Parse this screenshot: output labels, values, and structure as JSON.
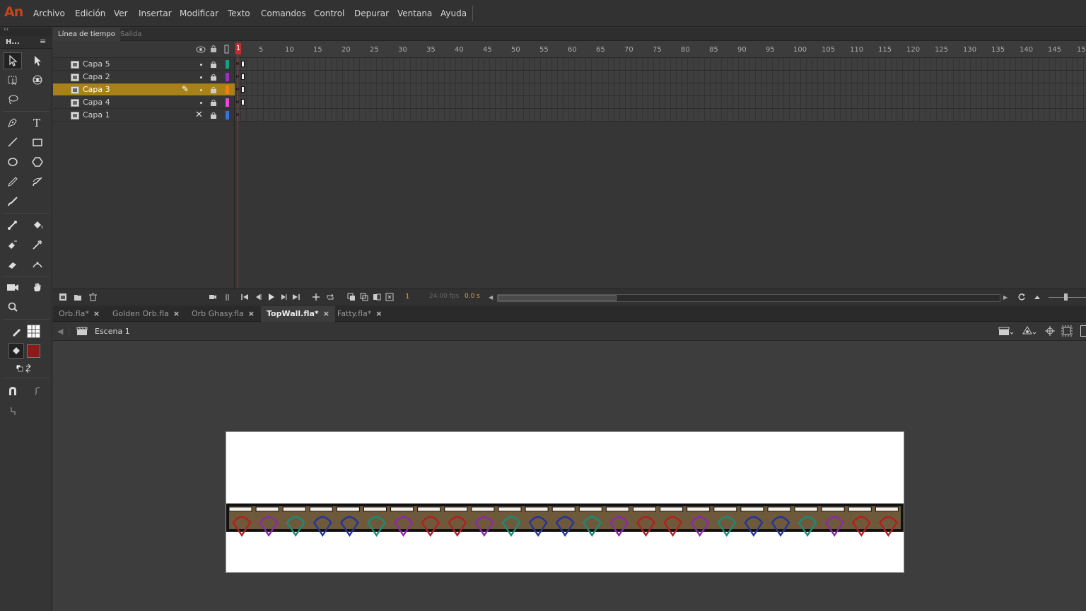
{
  "app": {
    "logo": "An"
  },
  "menu": [
    "Archivo",
    "Edición",
    "Ver",
    "Insertar",
    "Modificar",
    "Texto",
    "Comandos",
    "Control",
    "Depurar",
    "Ventana",
    "Ayuda"
  ],
  "tools_panel": {
    "tab_label": "H..."
  },
  "timeline": {
    "tabs": [
      "Línea de tiempo",
      "Salida"
    ],
    "ruler_numbers": [
      "1",
      "5",
      "10",
      "15",
      "20",
      "25",
      "30",
      "35",
      "40",
      "45",
      "50",
      "55",
      "60",
      "65",
      "70",
      "75",
      "80",
      "85",
      "90",
      "95",
      "100",
      "105",
      "110",
      "115",
      "120",
      "125",
      "130",
      "135",
      "140",
      "145",
      "15"
    ],
    "layers": [
      {
        "name": "Capa 5",
        "color": "#14a18a"
      },
      {
        "name": "Capa 2",
        "color": "#9b2fc7"
      },
      {
        "name": "Capa 3",
        "color": "#f07f10"
      },
      {
        "name": "Capa 4",
        "color": "#e84ad8"
      },
      {
        "name": "Capa 1",
        "color": "#3a72e0"
      }
    ],
    "selected_layer": "Capa 3",
    "current_frame": "1",
    "fps": "24.00 fps",
    "elapsed": "0.0 s"
  },
  "doc_tabs": [
    {
      "label": "Orb.fla*",
      "active": false
    },
    {
      "label": "Golden Orb.fla",
      "active": false
    },
    {
      "label": "Orb Ghasy.fla",
      "active": false
    },
    {
      "label": "TopWall.fla*",
      "active": true
    },
    {
      "label": "Fatty.fla*",
      "active": false
    }
  ],
  "scene": {
    "label": "Escena 1"
  },
  "colors": {
    "stroke": "#ffffff",
    "fill": "#8b1a1a",
    "accent_playhead": "#c03030",
    "selected_layer_bg": "#a8811a"
  },
  "artwork": {
    "orb_colors": [
      "#b02020",
      "#8a2aa8",
      "#1a8a78",
      "#24349a",
      "#24349a",
      "#1a8a78",
      "#8a2aa8",
      "#b02020",
      "#b02020",
      "#8a2aa8",
      "#1a8a78",
      "#24349a",
      "#24349a",
      "#1a8a78",
      "#8a2aa8",
      "#b02020",
      "#b02020",
      "#8a2aa8",
      "#1a8a78",
      "#24349a",
      "#24349a",
      "#1a8a78",
      "#8a2aa8",
      "#b02020",
      "#b02020"
    ]
  }
}
